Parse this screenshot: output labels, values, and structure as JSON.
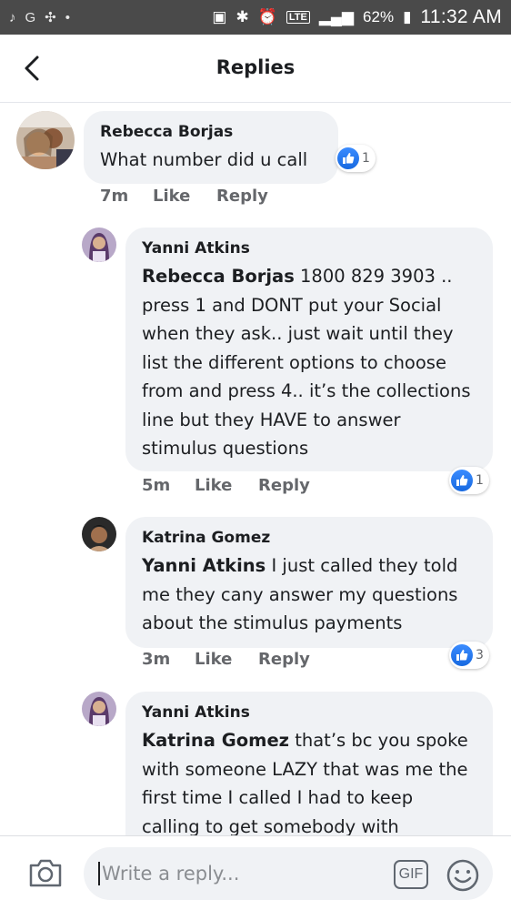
{
  "status_bar": {
    "left_icons": [
      "♪",
      "G",
      "✣",
      "•"
    ],
    "lte": "LTE",
    "battery": "62%",
    "time": "11:32 AM"
  },
  "header": {
    "title": "Replies"
  },
  "comments": [
    {
      "author": "Rebecca Borjas",
      "mention": "",
      "text": "What number did u call",
      "time": "7m",
      "like_label": "Like",
      "reply_label": "Reply",
      "reaction_count": "1"
    },
    {
      "author": "Yanni Atkins",
      "mention": "Rebecca Borjas",
      "text": " 1800 829 3903 .. press 1 and DONT put your Social when they ask.. just wait until they list the different options to choose from and press 4.. it’s the collections line but they HAVE to answer stimulus questions",
      "time": "5m",
      "like_label": "Like",
      "reply_label": "Reply",
      "reaction_count": "1"
    },
    {
      "author": "Katrina Gomez",
      "mention": "Yanni Atkins",
      "text": " I just called they told me they cany answer my questions about the stimulus payments",
      "time": "3m",
      "like_label": "Like",
      "reply_label": "Reply",
      "reaction_count": "3"
    },
    {
      "author": "Yanni Atkins",
      "mention": "Katrina Gomez",
      "text": " that’s bc you spoke with someone LAZY that was me the first time I called I had to keep calling to get somebody with"
    }
  ],
  "composer": {
    "placeholder": "Write a reply...",
    "gif_label": "GIF"
  },
  "colors": {
    "bubble": "#f0f2f5",
    "like_blue": "#1877f2",
    "meta_gray": "#65676b",
    "status_bar": "#4a4a4a"
  },
  "icons": [
    "back-arrow-icon",
    "like-thumb-icon",
    "camera-icon",
    "gif-icon",
    "emoji-icon"
  ]
}
